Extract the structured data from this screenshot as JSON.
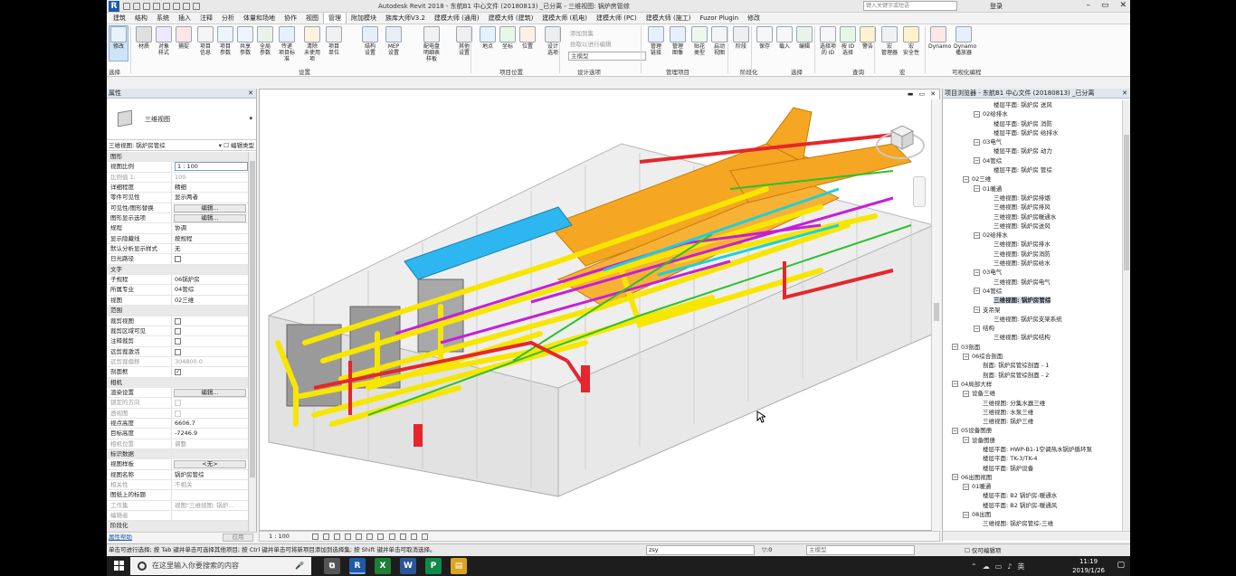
{
  "title": {
    "app": "Autodesk Revit 2018 -",
    "doc": "东航B1 中心文件 (20180813) _已分离 - 三维视图: 锅炉房管综",
    "search_placeholder": "键入关键字或短语",
    "login": "登录"
  },
  "tabs": [
    "建筑",
    "结构",
    "系统",
    "插入",
    "注释",
    "分析",
    "体量和场地",
    "协作",
    "视图",
    "管理",
    "附加模块",
    "族库大师V3.2",
    "建模大师 (通用)",
    "建模大师 (建筑)",
    "建模大师 (机电)",
    "建模大师 (PC)",
    "建模大师 (施工)",
    "Fuzor Plugin",
    "修改"
  ],
  "active_tab": "管理",
  "ribbon": {
    "buttons": [
      {
        "label": "修改",
        "icon": "cursor-icon"
      },
      {
        "label": "材质",
        "icon": "material-sphere-icon"
      },
      {
        "label": "对象\n样式",
        "icon": "object-styles-icon"
      },
      {
        "label": "捕捉",
        "icon": "magnet-icon"
      },
      {
        "label": "项目\n信息",
        "icon": "project-info-icon"
      },
      {
        "label": "项目\n参数",
        "icon": "project-parameters-icon"
      },
      {
        "label": "共享\n参数",
        "icon": "shared-parameters-icon"
      },
      {
        "label": "全局\n参数",
        "icon": "global-parameters-icon"
      },
      {
        "label": "传递\n项目标准",
        "icon": "transfer-standards-icon"
      },
      {
        "label": "清除\n未使用项",
        "icon": "purge-icon"
      },
      {
        "label": "项目\n单位",
        "icon": "units-icon"
      },
      {
        "label": "结构\n设置",
        "icon": "structural-settings-icon"
      },
      {
        "label": "MEP\n设置",
        "icon": "mep-settings-icon"
      },
      {
        "label": "配电盘明细表\n样板",
        "icon": "panel-schedule-icon"
      },
      {
        "label": "其他\n设置",
        "icon": "wrench-icon"
      },
      {
        "label": "地点",
        "icon": "globe-icon"
      },
      {
        "label": "坐标",
        "icon": "coordinates-icon"
      },
      {
        "label": "位置",
        "icon": "position-icon"
      },
      {
        "label": "设计\n选项",
        "icon": "design-options-icon"
      },
      {
        "label": "管理\n链接",
        "icon": "manage-links-icon"
      },
      {
        "label": "管理\n图像",
        "icon": "manage-images-icon"
      },
      {
        "label": "贴花\n类型",
        "icon": "decal-types-icon"
      },
      {
        "label": "启动\n视图",
        "icon": "starting-view-icon"
      },
      {
        "label": "阶段",
        "icon": "phases-icon"
      },
      {
        "label": "保存",
        "icon": "save-selection-icon"
      },
      {
        "label": "载入",
        "icon": "load-selection-icon"
      },
      {
        "label": "编辑",
        "icon": "edit-selection-icon"
      },
      {
        "label": "选择项\n的 ID",
        "icon": "ids-of-selection-icon"
      },
      {
        "label": "按 ID\n选择",
        "icon": "select-by-id-icon"
      },
      {
        "label": "警告",
        "icon": "warnings-icon"
      },
      {
        "label": "宏\n管理器",
        "icon": "macro-manager-icon"
      },
      {
        "label": "宏\n安全性",
        "icon": "macro-security-icon"
      },
      {
        "label": "Dynamo",
        "icon": "dynamo-icon"
      },
      {
        "label": "Dynamo\n播放器",
        "icon": "dynamo-player-icon"
      }
    ],
    "small_items": [
      "添加到集",
      "拾取以进行编辑"
    ],
    "main_model": "主模型",
    "groups": [
      "选择",
      "设置",
      "项目位置",
      "设计选项",
      "管理项目",
      "阶段化",
      "选择",
      "查询",
      "宏",
      "可视化编程"
    ]
  },
  "properties": {
    "title": "属性",
    "type_name": "三维视图",
    "instance_label": "三维视图: 锅炉房管综",
    "edit_type": "编辑类型",
    "rows": [
      {
        "type": "cat",
        "k": "图形"
      },
      {
        "type": "box",
        "k": "视图比例",
        "v": "1 : 100"
      },
      {
        "type": "dim",
        "k": "比例值 1:",
        "v": "100"
      },
      {
        "type": "kv",
        "k": "详细程度",
        "v": "精细"
      },
      {
        "type": "kv",
        "k": "零件可见性",
        "v": "显示两者"
      },
      {
        "type": "btn",
        "k": "可见性/图形替换",
        "v": "编辑..."
      },
      {
        "type": "btn",
        "k": "图形显示选项",
        "v": "编辑..."
      },
      {
        "type": "kv",
        "k": "规程",
        "v": "协调"
      },
      {
        "type": "kv",
        "k": "显示隐藏线",
        "v": "按规程"
      },
      {
        "type": "kv",
        "k": "默认分析显示样式",
        "v": "无"
      },
      {
        "type": "chk",
        "k": "日光路径",
        "on": false
      },
      {
        "type": "cat",
        "k": "文字"
      },
      {
        "type": "kv",
        "k": "子规程",
        "v": "06锅炉房"
      },
      {
        "type": "kv",
        "k": "所属专业",
        "v": "04管综"
      },
      {
        "type": "kv",
        "k": "视图",
        "v": "02三维"
      },
      {
        "type": "cat",
        "k": "范围"
      },
      {
        "type": "chk",
        "k": "裁剪视图",
        "on": false
      },
      {
        "type": "chk",
        "k": "裁剪区域可见",
        "on": false
      },
      {
        "type": "chk",
        "k": "注释裁剪",
        "on": false
      },
      {
        "type": "chk",
        "k": "远剪裁激活",
        "on": false
      },
      {
        "type": "dim",
        "k": "远剪裁偏移",
        "v": "304800.0"
      },
      {
        "type": "chk",
        "k": "剖面框",
        "on": true
      },
      {
        "type": "cat",
        "k": "相机"
      },
      {
        "type": "btn",
        "k": "渲染设置",
        "v": "编辑..."
      },
      {
        "type": "dimchk",
        "k": "锁定的方向"
      },
      {
        "type": "dimchk",
        "k": "透视图"
      },
      {
        "type": "kv",
        "k": "视点高度",
        "v": "6606.7"
      },
      {
        "type": "kv",
        "k": "目标高度",
        "v": "-7246.9"
      },
      {
        "type": "dim",
        "k": "相机位置",
        "v": "调整"
      },
      {
        "type": "cat",
        "k": "标识数据"
      },
      {
        "type": "btn",
        "k": "视图样板",
        "v": "<无>"
      },
      {
        "type": "kv",
        "k": "视图名称",
        "v": "锅炉房管综"
      },
      {
        "type": "dim",
        "k": "相关性",
        "v": "不相关"
      },
      {
        "type": "kv",
        "k": "图纸上的标题",
        "v": ""
      },
      {
        "type": "dim",
        "k": "工作集",
        "v": "视图\"三维视图: 锅炉..."
      },
      {
        "type": "dim",
        "k": "编辑者",
        "v": ""
      },
      {
        "type": "cat",
        "k": "阶段化"
      }
    ],
    "help": "属性帮助",
    "apply": "应用"
  },
  "viewport": {
    "scale": "1 : 100",
    "colors": {
      "duct_orange": "#f5a623",
      "pipe_yellow": "#f7e600",
      "duct_blue": "#2eb6f0",
      "pipe_red": "#e5262c",
      "pipe_magenta": "#c51fd8",
      "pipe_green": "#2bc12b",
      "pipe_cyan": "#1ecfd9"
    }
  },
  "browser": {
    "title": "项目浏览器 - 东航B1 中心文件 (20180813) _已分离",
    "nodes": [
      {
        "lvl": 4,
        "t": "楼层平面: 锅炉房 送风"
      },
      {
        "lvl": 3,
        "t": "02给排水",
        "tog": "−"
      },
      {
        "lvl": 4,
        "t": "楼层平面: 锅炉房 消防"
      },
      {
        "lvl": 4,
        "t": "楼层平面: 锅炉房 给排水"
      },
      {
        "lvl": 3,
        "t": "03电气",
        "tog": "−"
      },
      {
        "lvl": 4,
        "t": "楼层平面: 锅炉房 动力"
      },
      {
        "lvl": 3,
        "t": "04管综",
        "tog": "−"
      },
      {
        "lvl": 4,
        "t": "楼层平面: 锅炉房 管综"
      },
      {
        "lvl": 2,
        "t": "02三维",
        "tog": "−"
      },
      {
        "lvl": 3,
        "t": "01暖通",
        "tog": "−"
      },
      {
        "lvl": 4,
        "t": "三维视图: 锅炉房排烟"
      },
      {
        "lvl": 4,
        "t": "三维视图: 锅炉房排风"
      },
      {
        "lvl": 4,
        "t": "三维视图: 锅炉房暖通水"
      },
      {
        "lvl": 4,
        "t": "三维视图: 锅炉房送风"
      },
      {
        "lvl": 3,
        "t": "02给排水",
        "tog": "−"
      },
      {
        "lvl": 4,
        "t": "三维视图: 锅炉房排水"
      },
      {
        "lvl": 4,
        "t": "三维视图: 锅炉房消防"
      },
      {
        "lvl": 4,
        "t": "三维视图: 锅炉房给水"
      },
      {
        "lvl": 3,
        "t": "03电气",
        "tog": "−"
      },
      {
        "lvl": 4,
        "t": "三维视图: 锅炉房电气"
      },
      {
        "lvl": 3,
        "t": "04管综",
        "tog": "−"
      },
      {
        "lvl": 4,
        "t": "三维视图: 锅炉房管综",
        "hl": true
      },
      {
        "lvl": 3,
        "t": "支吊架",
        "tog": "−"
      },
      {
        "lvl": 4,
        "t": "三维视图: 锅炉房支架系统"
      },
      {
        "lvl": 3,
        "t": "结构",
        "tog": "−"
      },
      {
        "lvl": 4,
        "t": "三维视图: 锅炉房结构"
      },
      {
        "lvl": 1,
        "t": "03剖面",
        "tog": "−"
      },
      {
        "lvl": 2,
        "t": "06综合剖面",
        "tog": "−"
      },
      {
        "lvl": 3,
        "t": "剖面: 锅炉房管综剖面 - 1"
      },
      {
        "lvl": 3,
        "t": "剖面: 锅炉房管综剖面 - 2"
      },
      {
        "lvl": 1,
        "t": "04局部大样",
        "tog": "−"
      },
      {
        "lvl": 2,
        "t": "设备三维",
        "tog": "−"
      },
      {
        "lvl": 3,
        "t": "三维视图: 分集水器三维"
      },
      {
        "lvl": 3,
        "t": "三维视图: 水泵三维"
      },
      {
        "lvl": 3,
        "t": "三维视图: 锅炉三维"
      },
      {
        "lvl": 1,
        "t": "05设备图册",
        "tog": "−"
      },
      {
        "lvl": 2,
        "t": "设备图册",
        "tog": "−"
      },
      {
        "lvl": 3,
        "t": "楼层平面: HWP-B1-1空调热水锅炉循环泵"
      },
      {
        "lvl": 3,
        "t": "楼层平面: TK-3/TK-4"
      },
      {
        "lvl": 3,
        "t": "楼层平面: 锅炉设备"
      },
      {
        "lvl": 1,
        "t": "06出图视图",
        "tog": "−"
      },
      {
        "lvl": 2,
        "t": "01暖通",
        "tog": "−"
      },
      {
        "lvl": 3,
        "t": "楼层平面: B2 锅炉房-暖通水"
      },
      {
        "lvl": 3,
        "t": "楼层平面: B2 锅炉房-暖通风"
      },
      {
        "lvl": 2,
        "t": "08出图",
        "tog": "−"
      },
      {
        "lvl": 3,
        "t": "三维视图: 锅炉房管综-三维"
      }
    ]
  },
  "statusbar": {
    "message": "单击可进行选择; 按 Tab 键并单击可选择其他项目; 按 Ctrl 键并单击可将新项目添加到选择集; 按 Shift 键并单击可取消选择。",
    "workset": "zsy",
    "count": "0",
    "model": "主模型",
    "readonly": "仅可编辑项"
  },
  "taskbar": {
    "search": "在这里输入你要搜索的内容",
    "time": "11:19",
    "date": "2019/1/26",
    "ime": "英"
  }
}
